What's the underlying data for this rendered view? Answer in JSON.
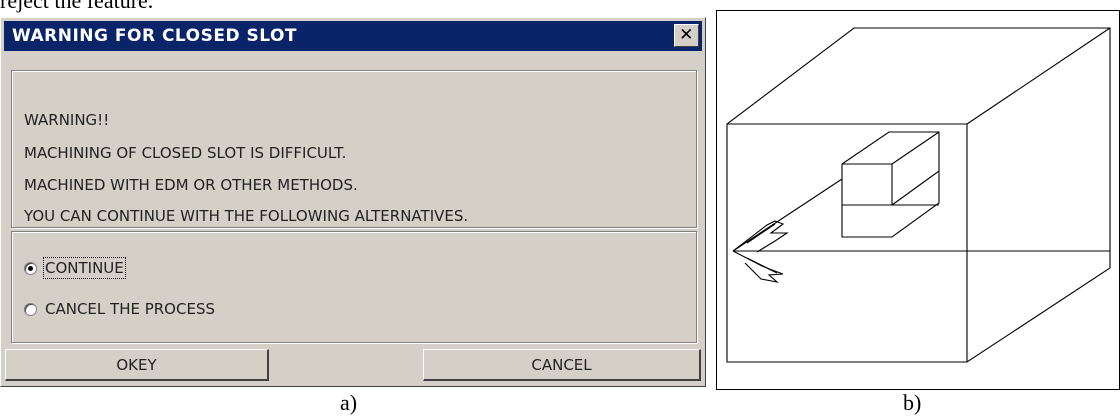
{
  "top_text": "reject the feature.",
  "dialog": {
    "title": "WARNING FOR CLOSED SLOT",
    "close_glyph": "✕",
    "messages": [
      "WARNING!!",
      "MACHINING OF CLOSED SLOT IS DIFFICULT.",
      "MACHINED WITH EDM OR OTHER METHODS.",
      "YOU CAN CONTINUE WITH THE FOLLOWING ALTERNATIVES."
    ],
    "options": [
      {
        "label": "CONTINUE",
        "selected": true
      },
      {
        "label": "CANCEL THE PROCESS",
        "selected": false
      }
    ],
    "okey_label": "OKEY",
    "cancel_label": "CANCEL"
  },
  "captions": {
    "a": "a)",
    "b": "b)"
  },
  "colors": {
    "titlebar": "#0a246a",
    "dialog_face": "#d4d0c8"
  }
}
